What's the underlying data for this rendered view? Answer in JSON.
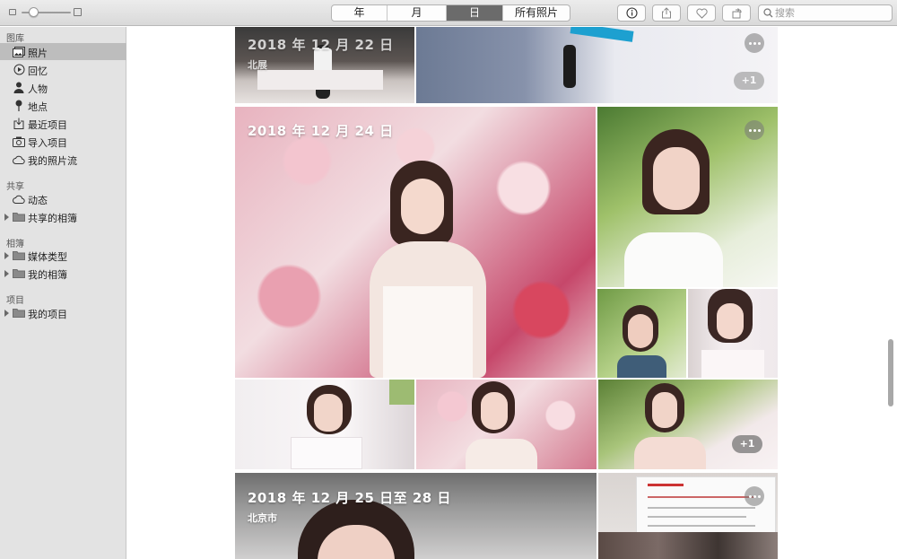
{
  "toolbar": {
    "segments": [
      "年",
      "月",
      "日",
      "所有照片"
    ],
    "active_segment": "日",
    "search_placeholder": "搜索",
    "buttons": [
      "info-icon",
      "share-icon",
      "heart-icon",
      "rotate-icon"
    ]
  },
  "sidebar": {
    "sections": [
      {
        "header": "图库",
        "items": [
          {
            "label": "照片",
            "icon": "photos-icon",
            "selected": true
          },
          {
            "label": "回忆",
            "icon": "memories-icon"
          },
          {
            "label": "人物",
            "icon": "person-icon"
          },
          {
            "label": "地点",
            "icon": "pin-icon"
          },
          {
            "label": "最近项目",
            "icon": "import-icon"
          },
          {
            "label": "导入项目",
            "icon": "camera-icon"
          },
          {
            "label": "我的照片流",
            "icon": "cloud-icon"
          }
        ]
      },
      {
        "header": "共享",
        "items": [
          {
            "label": "动态",
            "icon": "cloud-icon"
          },
          {
            "label": "共享的相簿",
            "icon": "folder-icon",
            "disclosure": true
          }
        ]
      },
      {
        "header": "相簿",
        "items": [
          {
            "label": "媒体类型",
            "icon": "folder-icon",
            "disclosure": true
          },
          {
            "label": "我的相簿",
            "icon": "folder-icon",
            "disclosure": true
          }
        ]
      },
      {
        "header": "项目",
        "items": [
          {
            "label": "我的项目",
            "icon": "folder-icon",
            "disclosure": true
          }
        ]
      }
    ]
  },
  "moments": [
    {
      "title": "2018 年 12 月 22 日",
      "location": "北展",
      "more_count": "+1"
    },
    {
      "title": "2018 年 12 月 24 日",
      "more_count": "+1"
    },
    {
      "title": "2018 年 12 月 25 日至 28 日",
      "location": "北京市"
    }
  ],
  "colors": {
    "sidebar_bg": "#e3e3e3",
    "sidebar_selected": "#bdbdbd",
    "segment_active": "#6b6b6b"
  }
}
